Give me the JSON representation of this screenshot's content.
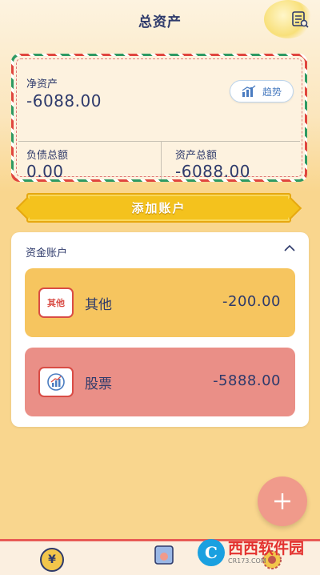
{
  "header": {
    "title": "总资产",
    "menu_icon": "list-icon"
  },
  "summary": {
    "net_label": "净资产",
    "net_value": "-6088.00",
    "trend_label": "趋势",
    "liability_label": "负债总额",
    "liability_value": "0.00",
    "asset_label": "资产总额",
    "asset_value": "-6088.00"
  },
  "add_account": {
    "label": "添加账户"
  },
  "accounts_panel": {
    "title": "资金账户",
    "items": [
      {
        "icon_text": "其他",
        "name": "其他",
        "amount": "-200.00",
        "color": "#f6c55f"
      },
      {
        "icon": "chart-icon",
        "name": "股票",
        "amount": "-5888.00",
        "color": "#ea8f87"
      }
    ]
  },
  "fab": {
    "icon": "plus-icon"
  },
  "bottom_tabs": {
    "items": [
      {
        "icon": "yuan-coin-icon",
        "symbol": "¥"
      },
      {
        "icon": "card-icon"
      },
      {
        "icon": "medal-icon"
      }
    ]
  },
  "watermark": {
    "letter": "C",
    "text": "西西软件园",
    "sub": "CR173.COM"
  },
  "colors": {
    "background": "#f9d68e",
    "accent_red": "#e85b55",
    "add_button": "#f4c21d",
    "text": "#2e3a6b"
  }
}
